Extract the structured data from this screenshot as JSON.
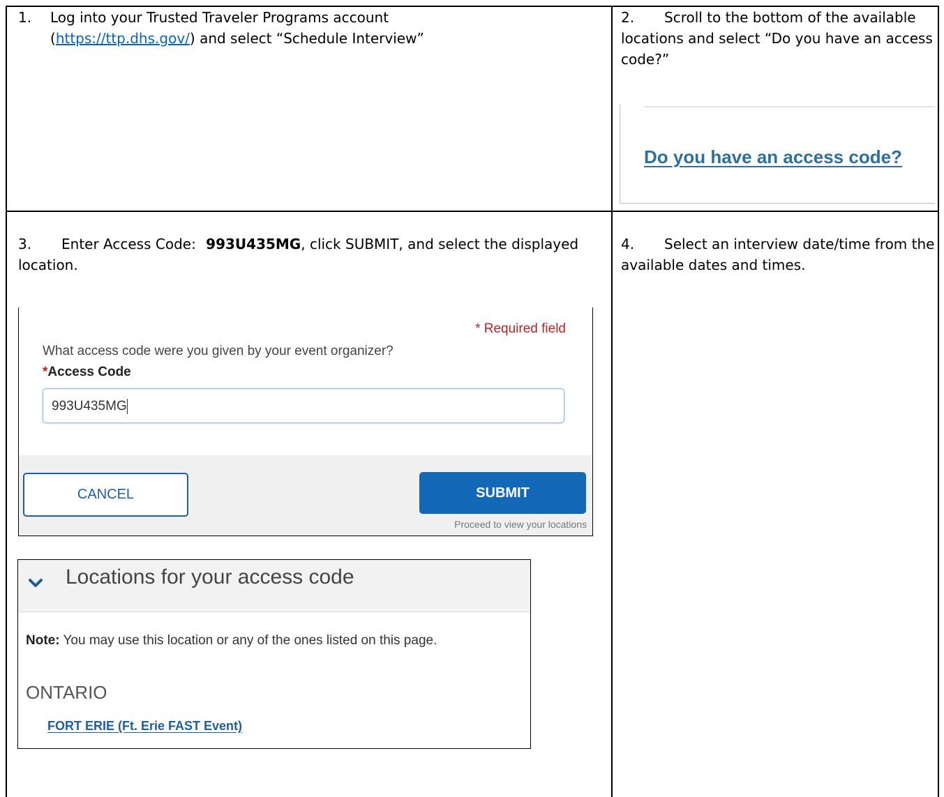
{
  "steps": {
    "s1": {
      "num": "1.",
      "text_a": "Log into your Trusted Traveler Programs account",
      "link": "https://ttp.dhs.gov/",
      "text_b": ") and select “Schedule Interview”"
    },
    "s2": {
      "num": "2.",
      "text": "Scroll to the bottom of the available locations and select “Do you have an access code?”",
      "image_link": "Do you have an access code?"
    },
    "s3": {
      "num": "3.",
      "text_a": "Enter Access Code:",
      "code": "993U435MG",
      "text_b": ", click SUBMIT, and select the displayed location."
    },
    "s4": {
      "num": "4.",
      "text": "Select an interview date/time from the available dates and times."
    }
  },
  "access_form": {
    "required_note": "* Required field",
    "question": "What access code were you given by your event organizer?",
    "label_star": "*",
    "label": "Access Code",
    "value": "993U435MG",
    "cancel": "CANCEL",
    "submit": "SUBMIT",
    "hint": "Proceed to view your locations"
  },
  "locations": {
    "title": "Locations for your access code",
    "note_label": "Note:",
    "note_text": " You may use this location or any of the ones listed on this page.",
    "state": "ONTARIO",
    "location": "FORT ERIE (Ft. Erie FAST Event)"
  },
  "colors": {
    "link_blue": "#1f5f9c",
    "button_blue": "#1468b8",
    "required_red": "#b4232a"
  }
}
